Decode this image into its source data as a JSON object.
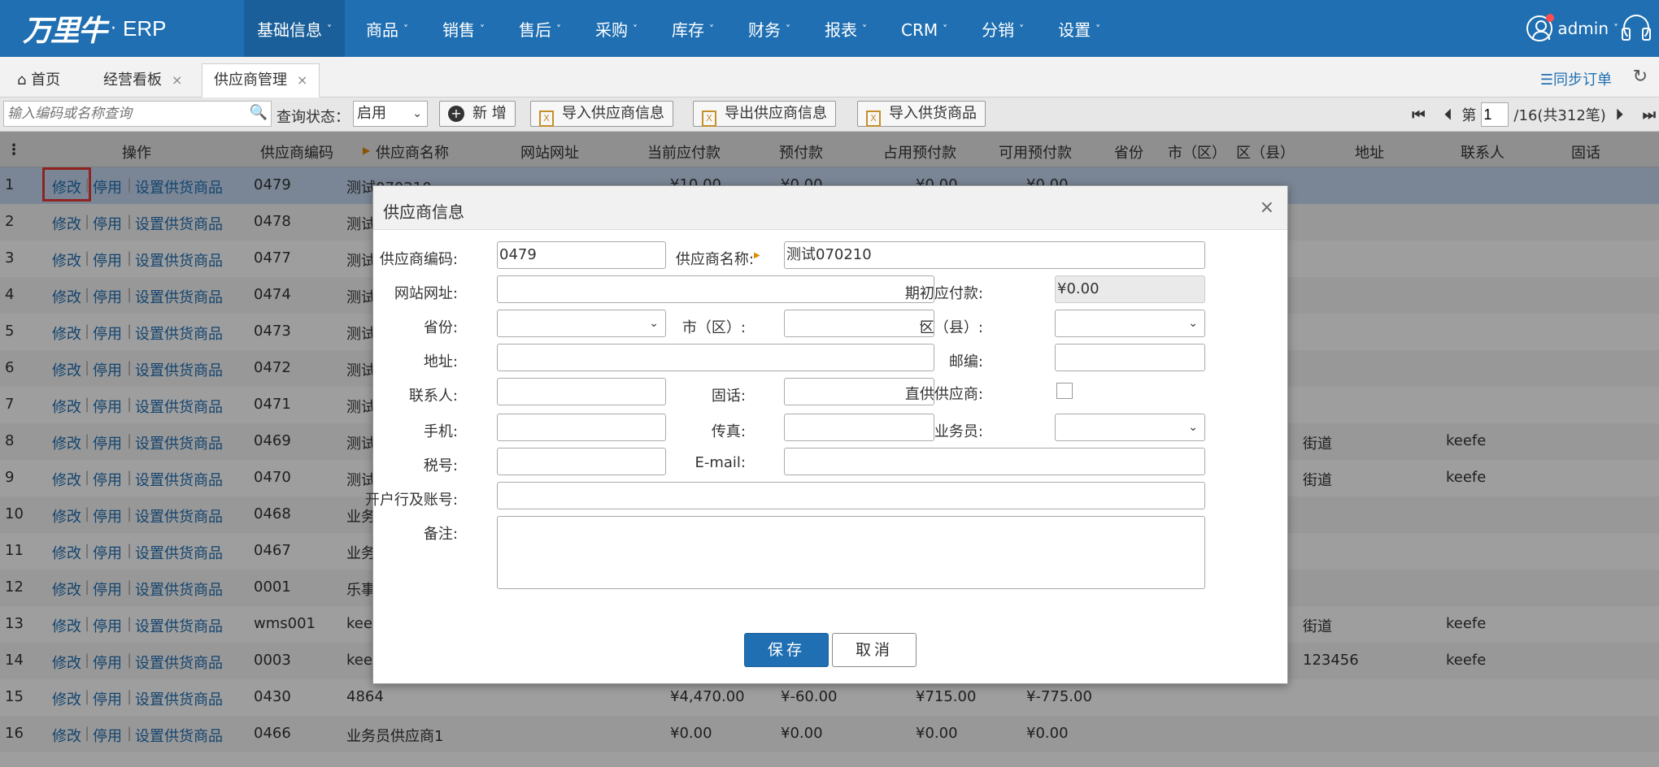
{
  "nav": {
    "brand": "万里牛",
    "dot": "·",
    "product": "ERP",
    "menus": [
      "基础信息",
      "商品",
      "销售",
      "售后",
      "采购",
      "库存",
      "财务",
      "报表",
      "CRM",
      "分销",
      "设置"
    ],
    "caret": "˅",
    "user": "admin",
    "user_caret": "˅"
  },
  "tabs": {
    "home": "首页",
    "dashboard": "经营看板",
    "supplier": "供应商管理",
    "close": "×",
    "sync_label": "☰同步订单",
    "refresh_glyph": "↻"
  },
  "toolbar": {
    "search_placeholder": "输入编码或名称查询",
    "status_label": "查询状态：",
    "status_value": "启用",
    "add_label": "新 增",
    "import_supplier": "导入供应商信息",
    "export_supplier": "导出供应商信息",
    "import_goods": "导入供货商品",
    "page_prefix": "第",
    "page_value": "1",
    "page_total": "/16(共312笔)"
  },
  "grid": {
    "headers": {
      "menu": "⋮",
      "ops": "操作",
      "code": "供应商编码",
      "name": "供应商名称",
      "site": "网站网址",
      "payable": "当前应付款",
      "prepaid": "预付款",
      "used_prepaid": "占用预付款",
      "avail_prepaid": "可用预付款",
      "province": "省份",
      "city": "市（区）",
      "district": "区（县）",
      "address": "地址",
      "contact": "联系人",
      "phone": "固话"
    },
    "op_edit": "修改",
    "op_disable": "停用",
    "op_set": "设置供货商品",
    "op_sep": "|",
    "rows": [
      {
        "no": "1",
        "code": "0479",
        "name": "测试070210",
        "payable": "¥10.00",
        "prepaid": "¥0.00",
        "used": "¥0.00",
        "avail": "¥0.00",
        "address": "",
        "contact": ""
      },
      {
        "no": "2",
        "code": "0478",
        "name": "测试",
        "payable": "",
        "prepaid": "",
        "used": "",
        "avail": "",
        "address": "",
        "contact": ""
      },
      {
        "no": "3",
        "code": "0477",
        "name": "测试",
        "payable": "",
        "prepaid": "",
        "used": "",
        "avail": "",
        "address": "",
        "contact": ""
      },
      {
        "no": "4",
        "code": "0474",
        "name": "测试",
        "payable": "",
        "prepaid": "",
        "used": "",
        "avail": "",
        "address": "",
        "contact": ""
      },
      {
        "no": "5",
        "code": "0473",
        "name": "测试",
        "payable": "",
        "prepaid": "",
        "used": "",
        "avail": "",
        "address": "",
        "contact": ""
      },
      {
        "no": "6",
        "code": "0472",
        "name": "测试",
        "payable": "",
        "prepaid": "",
        "used": "",
        "avail": "",
        "address": "",
        "contact": ""
      },
      {
        "no": "7",
        "code": "0471",
        "name": "测试",
        "payable": "",
        "prepaid": "",
        "used": "",
        "avail": "",
        "address": "",
        "contact": ""
      },
      {
        "no": "8",
        "code": "0469",
        "name": "测试",
        "payable": "",
        "prepaid": "",
        "used": "",
        "avail": "",
        "address": "街道",
        "contact": "keefe"
      },
      {
        "no": "9",
        "code": "0470",
        "name": "测试",
        "payable": "",
        "prepaid": "",
        "used": "",
        "avail": "",
        "address": "街道",
        "contact": "keefe"
      },
      {
        "no": "10",
        "code": "0468",
        "name": "业务",
        "payable": "",
        "prepaid": "",
        "used": "",
        "avail": "",
        "address": "",
        "contact": ""
      },
      {
        "no": "11",
        "code": "0467",
        "name": "业务",
        "payable": "",
        "prepaid": "",
        "used": "",
        "avail": "",
        "address": "",
        "contact": ""
      },
      {
        "no": "12",
        "code": "0001",
        "name": "乐事",
        "payable": "",
        "prepaid": "",
        "used": "",
        "avail": "",
        "address": "",
        "contact": ""
      },
      {
        "no": "13",
        "code": "wms001",
        "name": "kee",
        "payable": "",
        "prepaid": "",
        "used": "",
        "avail": "",
        "address": "街道",
        "contact": "keefe"
      },
      {
        "no": "14",
        "code": "0003",
        "name": "kee",
        "payable": "",
        "prepaid": "",
        "used": "",
        "avail": "",
        "address": "123456",
        "contact": "keefe"
      },
      {
        "no": "15",
        "code": "0430",
        "name": "4864",
        "payable": "¥4,470.00",
        "prepaid": "¥-60.00",
        "used": "¥715.00",
        "avail": "¥-775.00",
        "address": "",
        "contact": ""
      },
      {
        "no": "16",
        "code": "0466",
        "name": "业务员供应商1",
        "payable": "¥0.00",
        "prepaid": "¥0.00",
        "used": "¥0.00",
        "avail": "¥0.00",
        "address": "",
        "contact": ""
      }
    ]
  },
  "dialog": {
    "title": "供应商信息",
    "close": "×",
    "code_label": "供应商编码:",
    "code_value": "0479",
    "name_label": "供应商名称:",
    "name_value": "测试070210",
    "site_label": "网站网址:",
    "site_value": "",
    "opening_label": "期初应付款:",
    "opening_value": "¥0.00",
    "province_label": "省份:",
    "city_label": "市（区）:",
    "district_label": "区（县）:",
    "address_label": "地址:",
    "zip_label": "邮编:",
    "contact_label": "联系人:",
    "phone_label": "固话:",
    "direct_label": "直供供应商:",
    "mobile_label": "手机:",
    "fax_label": "传真:",
    "salesman_label": "业务员:",
    "tax_label": "税号:",
    "email_label": "E-mail:",
    "bank_label": "开户行及账号:",
    "remark_label": "备注:",
    "save": "保存",
    "cancel": "取消"
  }
}
